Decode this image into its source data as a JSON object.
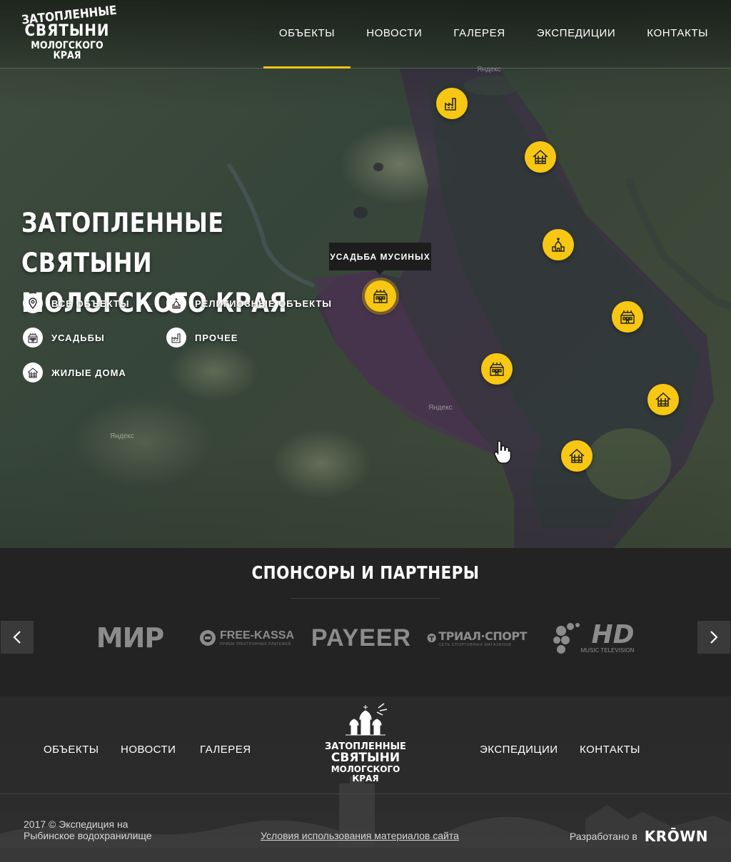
{
  "header": {
    "logo": {
      "line1": "ЗАТОПЛЕННЫЕ",
      "line2": "СВЯТЫНИ",
      "line3": "МОЛОГСКОГО КРАЯ"
    },
    "nav": [
      {
        "label": "ОБЪЕКТЫ",
        "active": true
      },
      {
        "label": "НОВОСТИ",
        "active": false
      },
      {
        "label": "ГАЛЕРЕЯ",
        "active": false
      },
      {
        "label": "ЭКСПЕДИЦИИ",
        "active": false
      },
      {
        "label": "КОНТАКТЫ",
        "active": false
      }
    ]
  },
  "hero": {
    "title_line1": "ЗАТОПЛЕННЫЕ СВЯТЫНИ",
    "title_line2": "МОЛОГСКОГО КРАЯ",
    "filters": [
      {
        "label": "ВСЕ ОБЪЕКТЫ",
        "icon": "map-pin-icon"
      },
      {
        "label": "РЕЛИГИОЗНЫЕ ОБЪЕКТЫ",
        "icon": "church-icon"
      },
      {
        "label": "УСАДЬБЫ",
        "icon": "manor-icon"
      },
      {
        "label": "ПРОЧЕЕ",
        "icon": "factory-icon"
      },
      {
        "label": "ЖИЛЫЕ ДОМА",
        "icon": "log-house-icon"
      }
    ],
    "tooltip": "УСАДЬБА МУСИНЫХ",
    "map_watermark": "Яндекс",
    "accent_color": "#f7c714"
  },
  "sponsors": {
    "title": "СПОНСОРЫ И ПАРТНЕРЫ",
    "partners": [
      {
        "name": "МИР",
        "sub": ""
      },
      {
        "name": "FREE-KASSA",
        "sub": "ПРИЕМ ЭЛЕКТРОННЫХ ПЛАТЕЖЕЙ"
      },
      {
        "name": "PAYEER",
        "sub": ""
      },
      {
        "name": "ТРИАЛ·СПОРТ",
        "sub": "СЕТЬ СПОРТИВНЫХ МАГАЗИНОВ"
      },
      {
        "name": "HD",
        "sub": "MUSIC TELEVISION"
      }
    ]
  },
  "footer": {
    "nav_left": [
      "ОБЪЕКТЫ",
      "НОВОСТИ",
      "ГАЛЕРЕЯ"
    ],
    "nav_right": [
      "ЭКСПЕДИЦИИ",
      "КОНТАКТЫ"
    ],
    "logo": {
      "line1": "ЗАТОПЛЕННЫЕ",
      "line2": "СВЯТЫНИ",
      "line3": "МОЛОГСКОГО КРАЯ"
    },
    "copyright": "2017 © Экспедиция на Рыбинское водохранилище",
    "terms": "Условия использования материалов сайта",
    "dev_label": "Разработано в",
    "dev_brand": "KRŌWN"
  }
}
